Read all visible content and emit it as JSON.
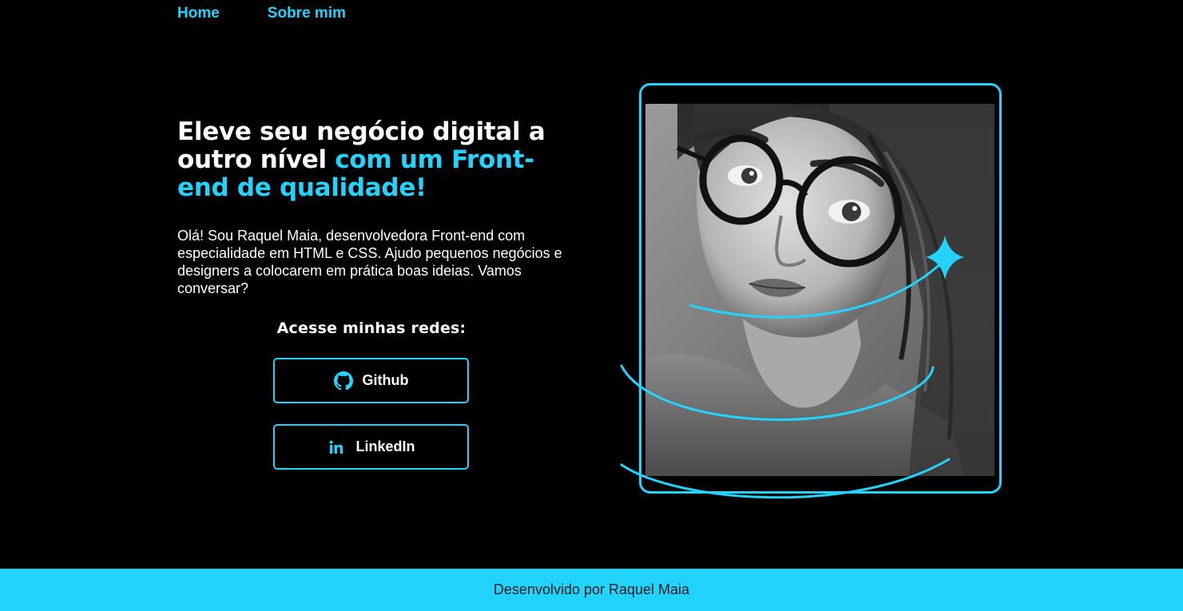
{
  "nav": {
    "items": [
      {
        "label": "Home"
      },
      {
        "label": "Sobre mim"
      }
    ]
  },
  "hero": {
    "headline_white": "Eleve seu negócio digital a outro nível ",
    "headline_accent": "com um Front-end de qualidade!",
    "intro": "Olá! Sou Raquel Maia, desenvolvedora Front-end com especialidade em HTML e CSS. Ajudo pequenos negócios e designers a colocarem em prática boas ideias. Vamos conversar?",
    "social_title": "Acesse minhas redes:",
    "buttons": [
      {
        "label": "Github",
        "icon": "github-icon"
      },
      {
        "label": "LinkedIn",
        "icon": "linkedin-icon"
      }
    ]
  },
  "portrait": {
    "alt": "Ilustração de uma mulher de óculos",
    "frame_icon": "sparkle-icon"
  },
  "footer": {
    "text": "Desenvolvido por Raquel Maia"
  },
  "colors": {
    "accent": "#22d4fd",
    "background": "#000000",
    "text": "#ffffff",
    "footer_text": "#1c1c1c"
  }
}
